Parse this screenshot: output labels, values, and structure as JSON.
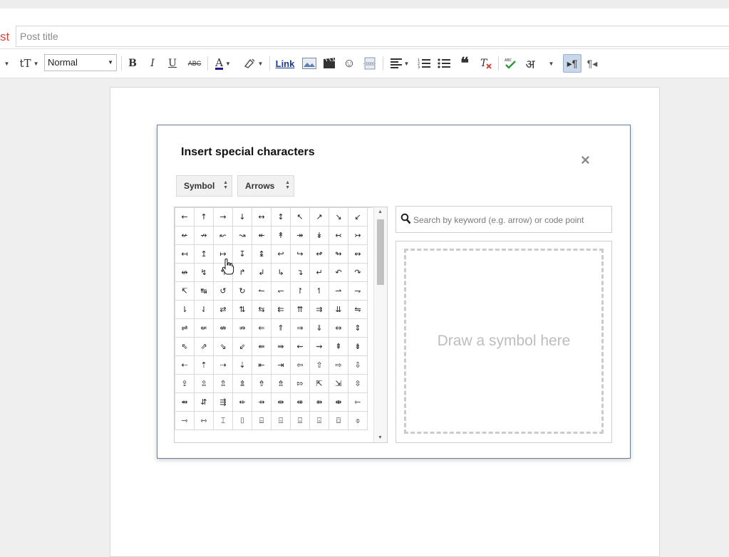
{
  "header": {
    "title_fragment": "st",
    "post_title_placeholder": "Post title"
  },
  "toolbar": {
    "format_value": "Normal",
    "link_label": "Link",
    "hindi_label": "अ"
  },
  "dialog": {
    "title": "Insert special characters",
    "close_label": "×",
    "category_select": "Symbol",
    "subcategory_select": "Arrows",
    "search_placeholder": "Search by keyword (e.g. arrow) or code point",
    "draw_placeholder": "Draw a symbol here",
    "characters": [
      [
        "←",
        "↑",
        "→",
        "↓",
        "↔",
        "↕",
        "↖",
        "↗",
        "↘",
        "↙"
      ],
      [
        "↚",
        "↛",
        "↜",
        "↝",
        "↞",
        "↟",
        "↠",
        "↡",
        "↢",
        "↣"
      ],
      [
        "↤",
        "↥",
        "↦",
        "↧",
        "↨",
        "↩",
        "↪",
        "↫",
        "↬",
        "↭"
      ],
      [
        "↮",
        "↯",
        "↰",
        "↱",
        "↲",
        "↳",
        "↴",
        "↵",
        "↶",
        "↷"
      ],
      [
        "↸",
        "↹",
        "↺",
        "↻",
        "↼",
        "↽",
        "↾",
        "↿",
        "⇀",
        "⇁"
      ],
      [
        "⇂",
        "⇃",
        "⇄",
        "⇅",
        "⇆",
        "⇇",
        "⇈",
        "⇉",
        "⇊",
        "⇋"
      ],
      [
        "⇌",
        "⇍",
        "⇎",
        "⇏",
        "⇐",
        "⇑",
        "⇒",
        "⇓",
        "⇔",
        "⇕"
      ],
      [
        "⇖",
        "⇗",
        "⇘",
        "⇙",
        "⇚",
        "⇛",
        "⇜",
        "⇝",
        "⇞",
        "⇟"
      ],
      [
        "⇠",
        "⇡",
        "⇢",
        "⇣",
        "⇤",
        "⇥",
        "⇦",
        "⇧",
        "⇨",
        "⇩"
      ],
      [
        "⇪",
        "⇫",
        "⇬",
        "⇭",
        "⇮",
        "⇯",
        "⇰",
        "⇱",
        "⇲",
        "⇳"
      ],
      [
        "⇴",
        "⇵",
        "⇶",
        "⇷",
        "⇸",
        "⇹",
        "⇺",
        "⇻",
        "⇼",
        "⇽"
      ],
      [
        "⇾",
        "⇿",
        "⌶",
        "⌷",
        "⌸",
        "⌹",
        "⌺",
        "⌻",
        "⌼",
        "⌽"
      ]
    ]
  },
  "colors": {
    "accent_red": "#d0473e",
    "link_blue": "#1a3a8f",
    "dialog_border": "#6a7d99"
  }
}
